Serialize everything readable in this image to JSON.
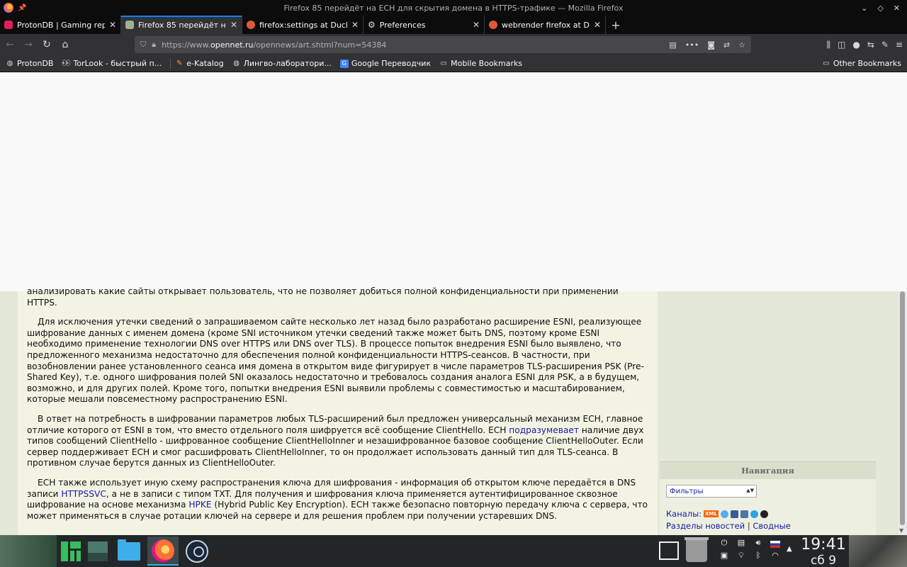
{
  "window": {
    "title": "Firefox 85 перейдёт на ECH для скрытия домена в HTTPS-трафике — Mozilla Firefox",
    "controls": [
      "⌄",
      "◇",
      "✕"
    ]
  },
  "tabs": [
    {
      "label": "ProtonDB | Gaming repor",
      "favicon_color": "#e01e5a",
      "active": false
    },
    {
      "label": "Firefox 85 перейдёт на ЕС",
      "favicon_color": "#9bb38f",
      "active": true
    },
    {
      "label": "firefox:settings at DuckDu",
      "favicon_color": "#de5833",
      "active": false
    },
    {
      "label": "Preferences",
      "favicon_color": "#d7d7db",
      "active": false
    },
    {
      "label": "webrender firefox at Duck",
      "favicon_color": "#de5833",
      "active": false
    }
  ],
  "nav": {
    "url_prefix": "https://www.",
    "url_domain": "opennet.ru",
    "url_path": "/opennews/art.shtml?num=54384"
  },
  "bookmarks": [
    {
      "label": "ProtonDB",
      "icon": "globe-icon"
    },
    {
      "label": "TorLook - быстрый п...",
      "icon": "eyes-icon"
    },
    {
      "label": "e-Katalog",
      "icon": "pen-icon"
    },
    {
      "label": "Лингво-лаборатори...",
      "icon": "globe-icon"
    },
    {
      "label": "Google Переводчик",
      "icon": "translate-icon"
    },
    {
      "label": "Mobile Bookmarks",
      "icon": "folder-icon"
    }
  ],
  "other_bookmarks": "Other Bookmarks",
  "article": {
    "p0": "анализировать какие сайты открывает пользователь, что не позволяет добиться полной конфиденциальности при применении HTTPS.",
    "p1": "Для исключения утечки сведений о запрашиваемом сайте несколько лет назад было разработано расширение ESNI, реализующее шифрование данных с именем домена (кроме SNI источником утечки сведений также может быть DNS, поэтому кроме ESNI необходимо применение технологии DNS over HTTPS или DNS over TLS). В процессе попыток внедрения ESNI было выявлено, что предложенного механизма недостаточно для обеспечения полной конфиденциальности HTTPS-сеансов. В частности, при возобновлении ранее установленного сеанса имя домена в открытом виде фигурирует в числе параметров TLS-расширения PSK (Pre-Shared Key), т.е. одного шифрования полей SNI оказалось недостаточно и требовалось создания аналога ESNI для PSK, а в будущем, возможно, и для других полей. Кроме того, попытки внедрения ESNI выявили проблемы с совместимостью и масштабированием, которые мешали повсеместному распространению ESNI.",
    "p2_a": "В ответ на потребность в шифровании параметров любых TLS-расширений был предложен универсальный механизм ECH, главное отличие которого от ESNI в том, что вместо отдельного поля шифруется всё сообщение ClientHello. ECH ",
    "p2_link": "подразумевает",
    "p2_b": " наличие двух типов сообщений ClientHello - шифрованное сообщение ClientHelloInner и незашифрованное базовое сообщение ClientHelloOuter. Если сервер поддерживает ECH и смог расшифровать ClientHelloInner, то он продолжает использовать данный тип для TLS-сеанса. В противном случае берутся данных из ClientHelloOuter.",
    "p3_a": "ECH также использует иную схему распространения ключа для шифрования - информация об открытом ключе передаётся в DNS записи ",
    "p3_link1": "HTTPSSVC",
    "p3_b": ", а не в записи с типом TXT. Для получения и шифрования ключа применяется аутентифицированное сквозное шифрование на основе механизма ",
    "p3_link2": "HPKE",
    "p3_c": " (Hybrid Public Key Encryption). ECH также безопасно повторную передачу ключа с сервера, что может применяться в случае ротации ключей на сервере и для решения проблем при получении устаревших",
    "p3_d": "DNS."
  },
  "sidebar": {
    "nav_title": "Навигация",
    "filter_select": "Фильтры",
    "channels_label": "Каналы:",
    "xml_badge": "XML",
    "sections_link": "Разделы новостей",
    "separator": "|",
    "summary_link": "Сводные"
  },
  "taskbar": {
    "time": "19:41",
    "date": "сб 9"
  }
}
